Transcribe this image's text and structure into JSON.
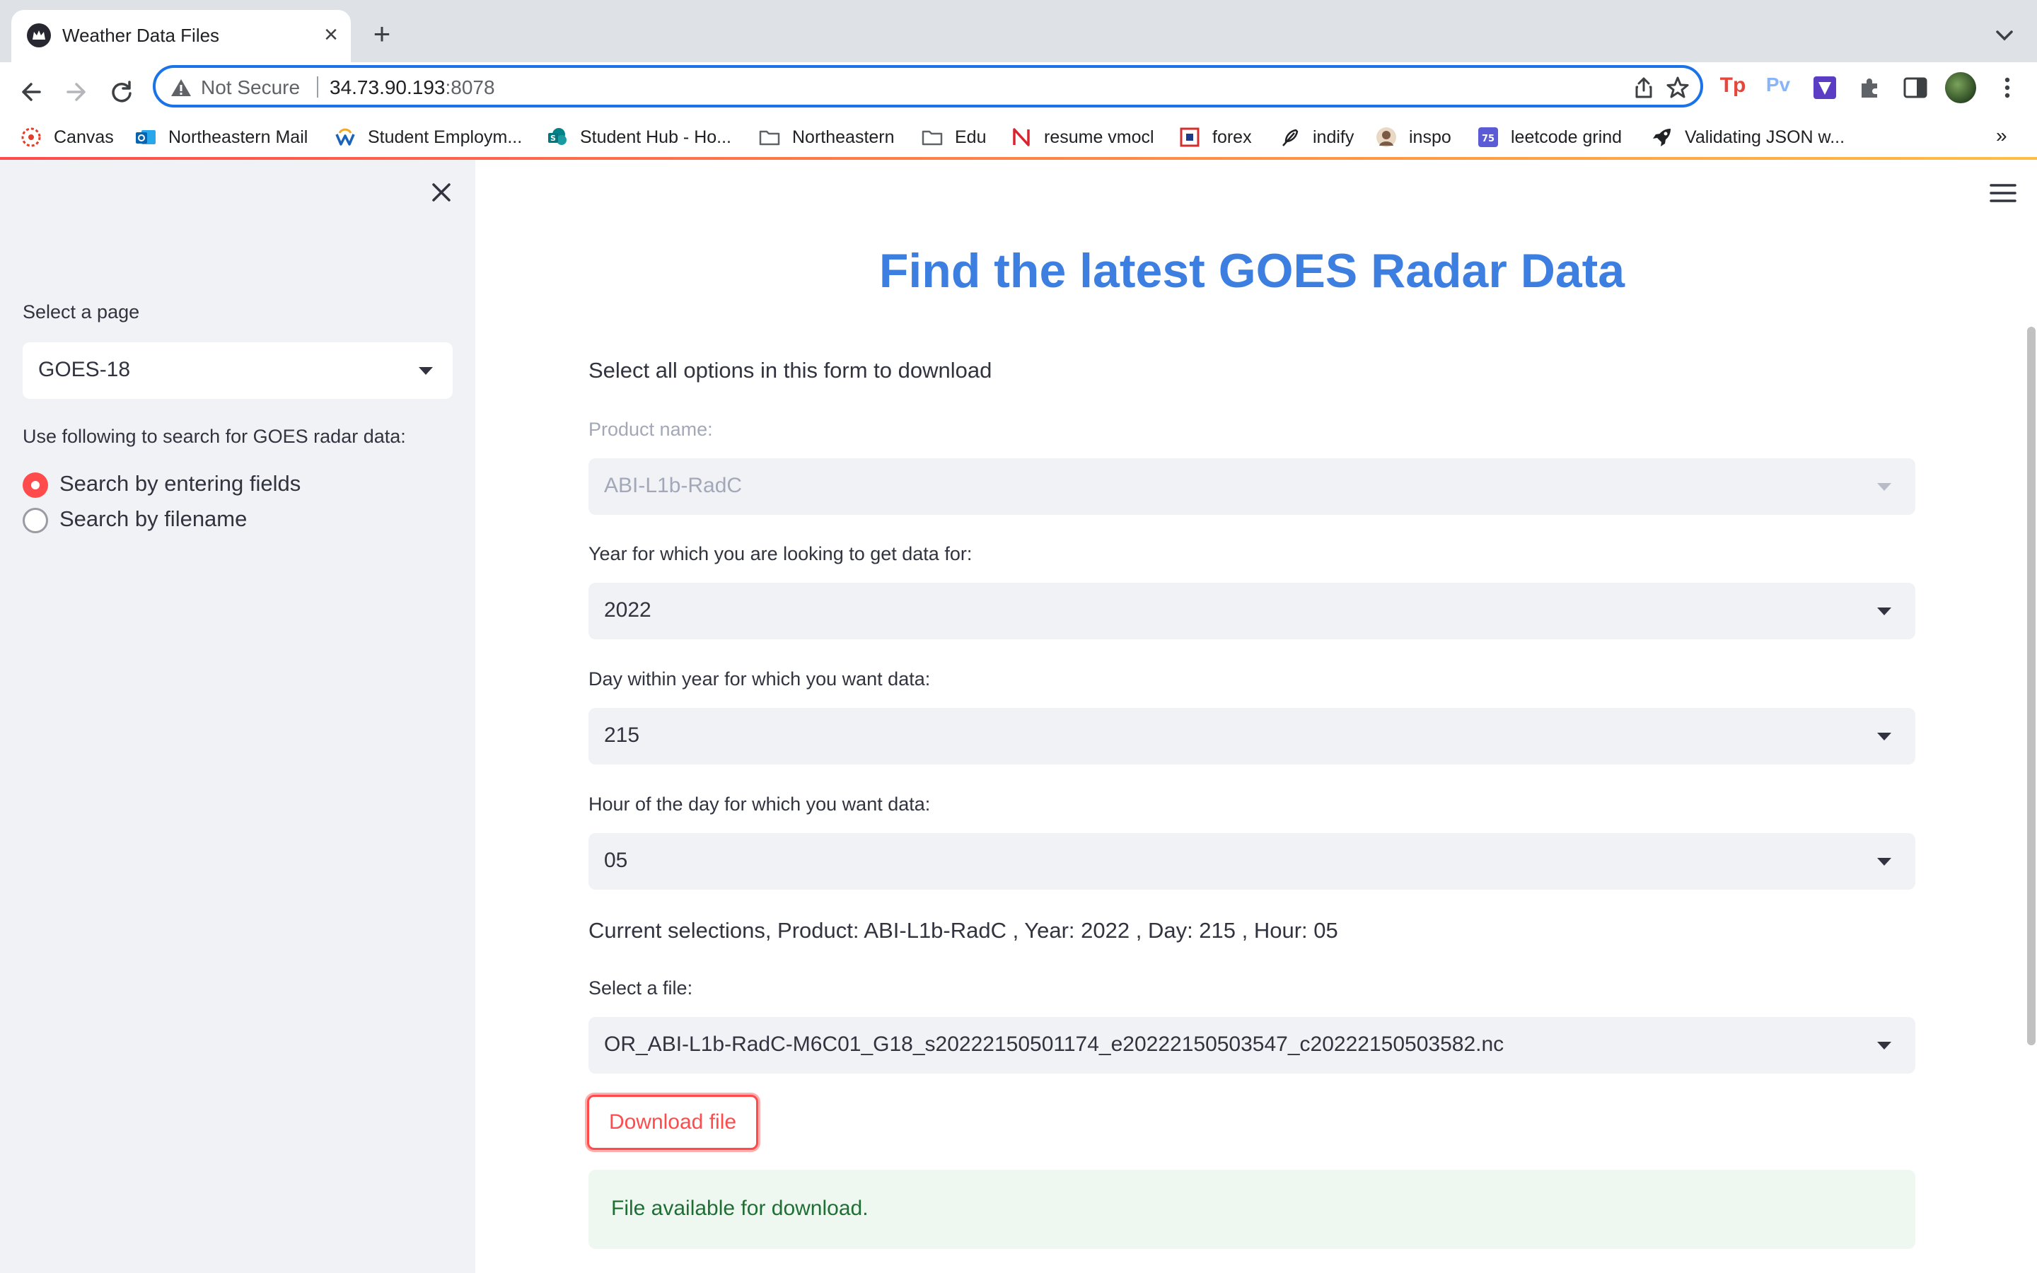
{
  "browser": {
    "tab_title": "Weather Data Files",
    "security_label": "Not Secure",
    "url_host": "34.73.90.193",
    "url_port": ":8078",
    "bookmarks": [
      {
        "label": "Canvas",
        "icon": "canvas-icon"
      },
      {
        "label": "Northeastern Mail",
        "icon": "outlook-icon"
      },
      {
        "label": "Student Employm...",
        "icon": "workday-icon"
      },
      {
        "label": "Student Hub - Ho...",
        "icon": "sharepoint-icon"
      },
      {
        "label": "Northeastern",
        "icon": "folder-icon"
      },
      {
        "label": "Edu",
        "icon": "folder-icon"
      },
      {
        "label": "resume vmocl",
        "icon": "n-logo-icon"
      },
      {
        "label": "forex",
        "icon": "forex-icon"
      },
      {
        "label": "indify",
        "icon": "feather-icon"
      },
      {
        "label": "inspo",
        "icon": "avatar-icon"
      },
      {
        "label": "leetcode grind",
        "icon": "calendar-75-icon"
      },
      {
        "label": "Validating JSON w...",
        "icon": "rocket-icon"
      }
    ],
    "extensions": [
      {
        "label": "Tp",
        "color": "#e8453c"
      },
      {
        "label": "Pv",
        "color": "#8ab4f8"
      }
    ],
    "calendar_badge": "75",
    "overflow_label": "»"
  },
  "sidebar": {
    "select_page_label": "Select a page",
    "selected_page": "GOES-18",
    "search_prompt": "Use following to search for GOES radar data:",
    "radio_options": [
      {
        "label": "Search by entering fields",
        "selected": true
      },
      {
        "label": "Search by filename",
        "selected": false
      }
    ]
  },
  "main": {
    "title": "Find the latest GOES Radar Data",
    "intro": "Select all options in this form to download",
    "fields": [
      {
        "label": "Product name:",
        "value": "ABI-L1b-RadC",
        "disabled": true
      },
      {
        "label": "Year for which you are looking to get data for:",
        "value": "2022",
        "disabled": false
      },
      {
        "label": "Day within year for which you want data:",
        "value": "215",
        "disabled": false
      },
      {
        "label": "Hour of the day for which you want data:",
        "value": "05",
        "disabled": false
      }
    ],
    "summary": "Current selections, Product: ABI-L1b-RadC , Year: 2022 , Day: 215 , Hour: 05",
    "file_label": "Select a file:",
    "file_value": "OR_ABI-L1b-RadC-M6C01_G18_s20222150501174_e20222150503547_c20222150503582.nc",
    "download_label": "Download file",
    "success_message": "File available for download."
  },
  "colors": {
    "accent": "#ff4b4b",
    "title": "#3d7fe0",
    "success_bg": "#eff8f0",
    "success_text": "#1f6f35",
    "sidebar_bg": "#f0f2f6"
  }
}
